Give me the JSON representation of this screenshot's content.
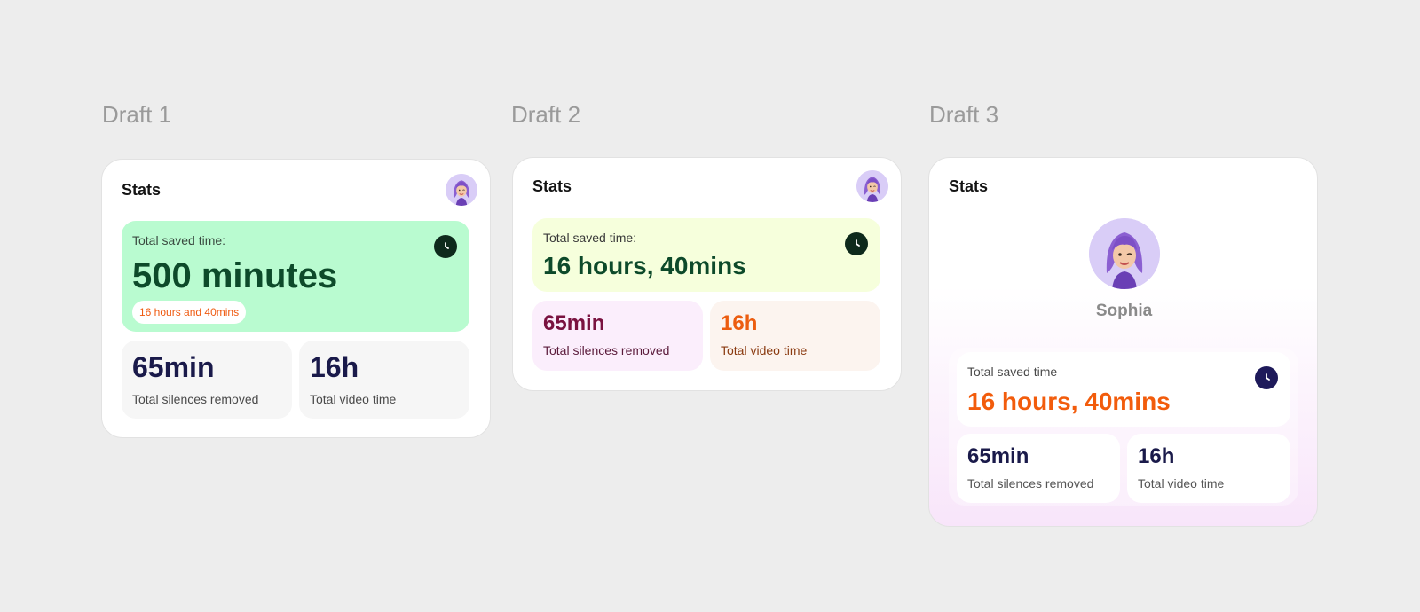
{
  "colors": {
    "background": "#ededed",
    "d1_hero_bg": "#b9fbd0",
    "d2_hero_bg": "#f6ffdc",
    "d2_silence_bg": "#fbeefc",
    "d2_video_bg": "#fcf4ef",
    "accent_orange": "#f25c0c",
    "clock_green": "#0e2a1c",
    "clock_navy": "#1e1a5a"
  },
  "drafts": [
    {
      "title": "Draft 1",
      "card_title": "Stats",
      "hero": {
        "label": "Total saved time:",
        "value": "500 minutes",
        "pill": "16 hours and 40mins",
        "icon": "clock-icon"
      },
      "stats": [
        {
          "value": "65min",
          "label": "Total silences removed"
        },
        {
          "value": "16h",
          "label": "Total video time"
        }
      ]
    },
    {
      "title": "Draft 2",
      "card_title": "Stats",
      "hero": {
        "label": "Total saved time:",
        "value": "16 hours, 40mins",
        "icon": "clock-icon"
      },
      "stats": [
        {
          "value": "65min",
          "label": "Total silences removed"
        },
        {
          "value": "16h",
          "label": "Total video time"
        }
      ]
    },
    {
      "title": "Draft 3",
      "card_title": "Stats",
      "user_name": "Sophia",
      "hero": {
        "label": "Total saved time",
        "value": "16 hours, 40mins",
        "icon": "clock-icon"
      },
      "stats": [
        {
          "value": "65min",
          "label": "Total silences removed"
        },
        {
          "value": "16h",
          "label": "Total video time"
        }
      ]
    }
  ]
}
